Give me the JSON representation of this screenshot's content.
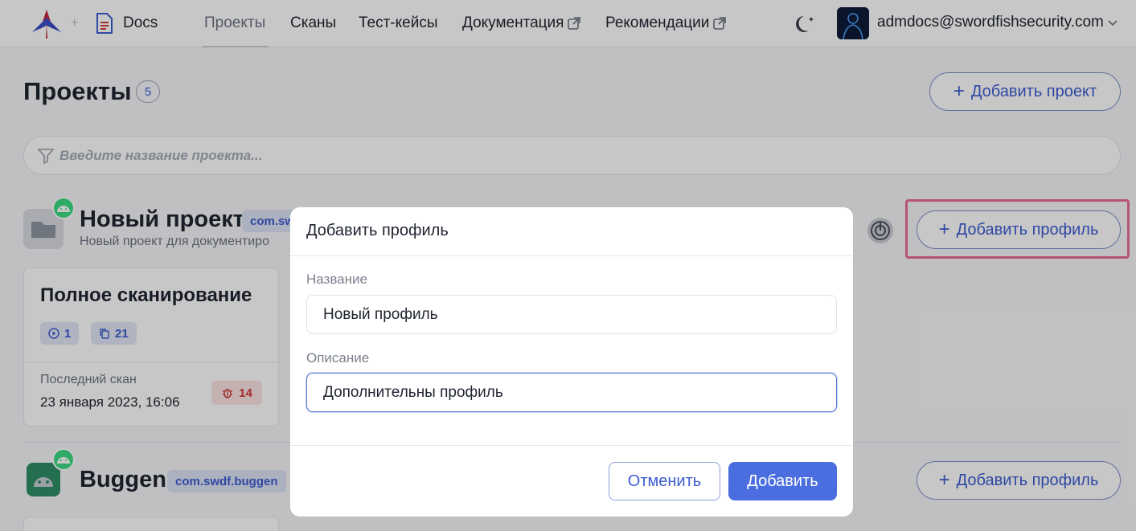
{
  "header": {
    "plus_separator": "+",
    "app_label": "Docs",
    "nav": [
      {
        "label": "Проекты",
        "active": true,
        "external": false
      },
      {
        "label": "Сканы",
        "active": false,
        "external": false
      },
      {
        "label": "Тест-кейсы",
        "active": false,
        "external": false
      },
      {
        "label": "Документация",
        "active": false,
        "external": true
      },
      {
        "label": "Рекомендации",
        "active": false,
        "external": true
      }
    ],
    "user_email": "admdocs@swordfishsecurity.com"
  },
  "page": {
    "title": "Проекты",
    "count": "5",
    "add_project_label": "Добавить проект",
    "search_placeholder": "Введите название проекта..."
  },
  "projects": [
    {
      "name": "Новый проект",
      "package": "com.sw",
      "description": "Новый проект для документиро",
      "add_profile_label": "Добавить профиль",
      "profile_card": {
        "title": "Полное сканирование",
        "scans": "1",
        "testcases": "21",
        "last_scan_label": "Последний скан",
        "last_scan_date": "23 января 2023, 16:06",
        "bugs": "14"
      }
    },
    {
      "name": "Buggen",
      "package": "com.swdf.buggen",
      "add_profile_label": "Добавить профиль"
    }
  ],
  "modal": {
    "title": "Добавить профиль",
    "name_label": "Название",
    "name_value": "Новый профиль",
    "description_label": "Описание",
    "description_value": "Дополнительны профиль",
    "cancel_label": "Отменить",
    "submit_label": "Добавить"
  },
  "colors": {
    "accent": "#4a6ee0",
    "highlight": "#ea6b93",
    "android": "#3ddc84"
  }
}
